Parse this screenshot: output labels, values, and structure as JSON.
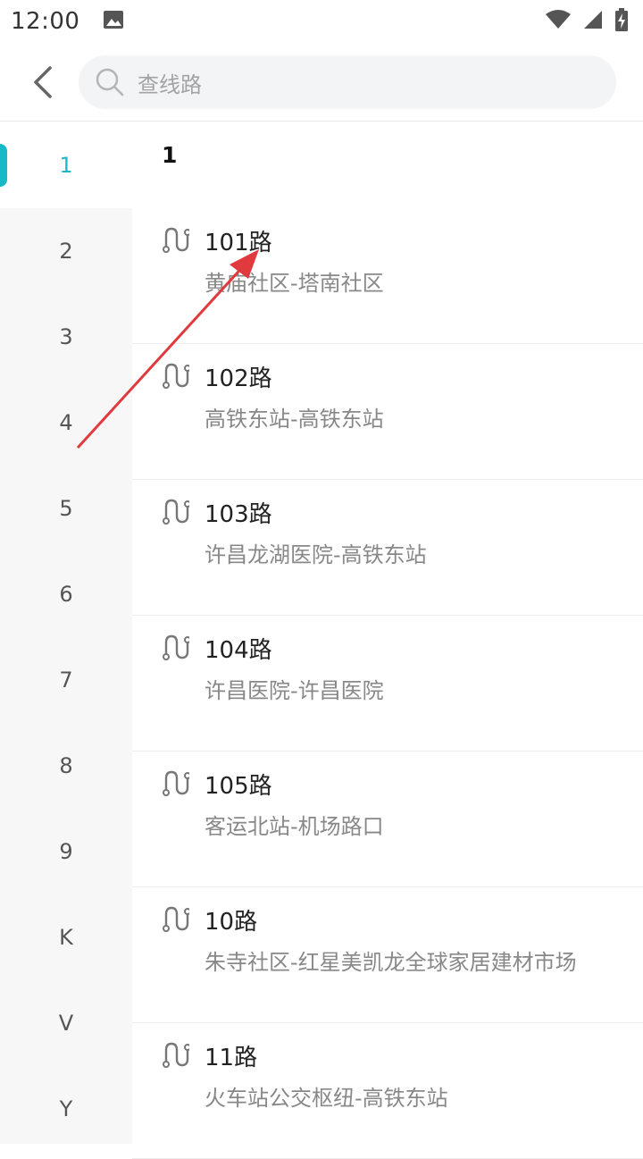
{
  "status_bar": {
    "time": "12:00"
  },
  "header": {
    "search_placeholder": "查线路"
  },
  "index": {
    "items": [
      "1",
      "2",
      "3",
      "4",
      "5",
      "6",
      "7",
      "8",
      "9",
      "K",
      "V",
      "Y"
    ],
    "active": "1"
  },
  "section": {
    "title": "1"
  },
  "routes": [
    {
      "name": "101路",
      "stops": "黄庙社区-塔南社区"
    },
    {
      "name": "102路",
      "stops": "高铁东站-高铁东站"
    },
    {
      "name": "103路",
      "stops": "许昌龙湖医院-高铁东站"
    },
    {
      "name": "104路",
      "stops": "许昌医院-许昌医院"
    },
    {
      "name": "105路",
      "stops": "客运北站-机场路口"
    },
    {
      "name": "10路",
      "stops": "朱寺社区-红星美凯龙全球家居建材市场"
    },
    {
      "name": "11路",
      "stops": "火车站公交枢纽-高铁东站"
    }
  ],
  "colors": {
    "accent": "#1fb5c9",
    "annotation": "#e0393e"
  },
  "icons": {
    "back": "chevron-left-icon",
    "search": "search-icon",
    "route": "route-icon"
  }
}
